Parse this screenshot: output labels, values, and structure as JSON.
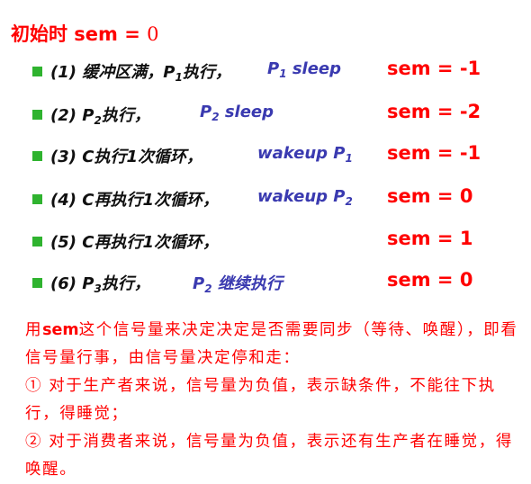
{
  "title": {
    "label": "初始时 sem = ",
    "value": "0"
  },
  "steps": [
    {
      "no": "(1)",
      "text": "缓冲区满，P",
      "sub": "1",
      "after": "执行，",
      "blue": "P",
      "blue_sub": "1",
      "blue_after": " sleep",
      "sem": "sem = -1"
    },
    {
      "no": "(2)",
      "text": "P",
      "sub": "2",
      "after": "执行，",
      "blue": "P",
      "blue_sub": "2",
      "blue_after": " sleep",
      "sem": "sem = -2"
    },
    {
      "no": "(3)",
      "text": "C执行1次循环，",
      "blue": "wakeup P",
      "blue_sub": "1",
      "sem": "sem = -1"
    },
    {
      "no": "(4)",
      "text": "C再执行1次循环，",
      "blue": "wakeup P",
      "blue_sub": "2",
      "sem": "sem = 0"
    },
    {
      "no": "(5)",
      "text": "C再执行1次循环，",
      "sem": "sem = 1"
    },
    {
      "no": "(6)",
      "text": "P",
      "sub": "3",
      "after": "执行，",
      "blue": "P",
      "blue_sub": "2",
      "blue_after": " 继续执行",
      "sem": "sem = 0"
    }
  ],
  "note": {
    "prefix": "用",
    "keyword": "sem",
    "line1_rest": "这个信号量来决定决定是否需要同步（等待、唤醒），即看信号量行事，由信号量决定停和走：",
    "item1": "① 对于生产者来说，信号量为负值，表示缺条件，不能往下执行，得睡觉；",
    "item2": "② 对于消费者来说，信号量为负值，表示还有生产者在睡觉，得唤醒。"
  }
}
